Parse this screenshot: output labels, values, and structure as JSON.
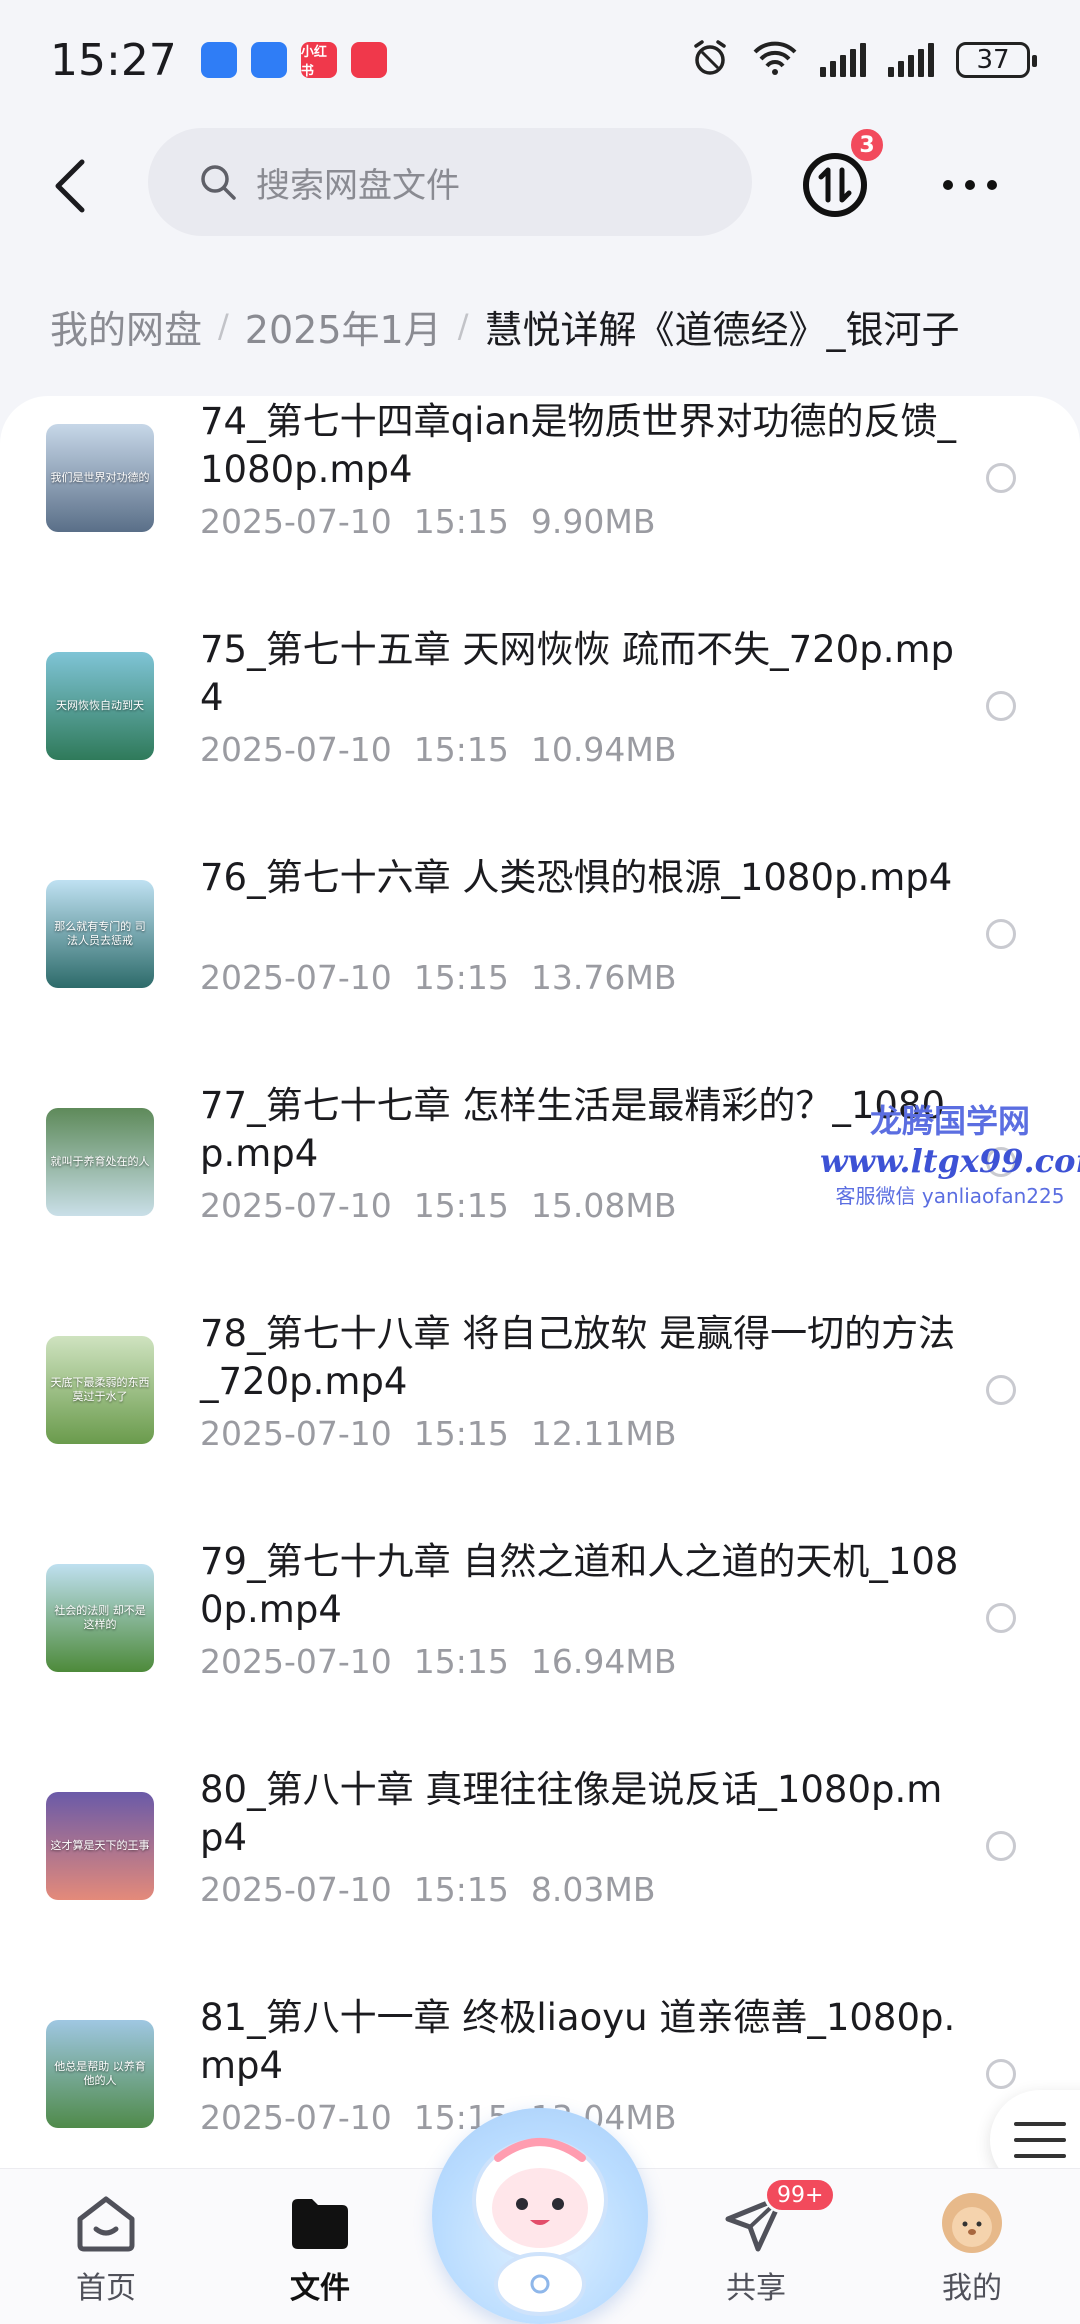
{
  "status_bar": {
    "time": "15:27",
    "notification_icons": [
      {
        "name": "app-notification-icon",
        "color": "#2f7df6",
        "text": ""
      },
      {
        "name": "app-notification-icon",
        "color": "#2f7df6",
        "text": ""
      },
      {
        "name": "xiaohongshu-icon",
        "color": "#f0384b",
        "text": "小红书"
      },
      {
        "name": "message-icon",
        "color": "#f0384b",
        "text": ""
      }
    ],
    "battery": "37"
  },
  "header": {
    "search_placeholder": "搜索网盘文件",
    "transfer_badge": "3"
  },
  "breadcrumb": {
    "items": [
      "我的网盘",
      "2025年1月"
    ],
    "current": "慧悦详解《道德经》_银河子"
  },
  "files": [
    {
      "name": "74_第七十四章qian是物质世界对功德的反馈_1080p.mp4",
      "date": "2025-07-10",
      "time": "15:15",
      "size": "9.90MB",
      "thumb_caption": "我们是世界对功德的",
      "thumb_colors": [
        "#c7d7e8",
        "#5a6f88"
      ]
    },
    {
      "name": "75_第七十五章  天网恢恢 疏而不失_720p.mp4",
      "date": "2025-07-10",
      "time": "15:15",
      "size": "10.94MB",
      "thumb_caption": "天网恢恢自动到天",
      "thumb_colors": [
        "#7fc4d6",
        "#2f7a5a"
      ]
    },
    {
      "name": "76_第七十六章 人类恐惧的根源_1080p.mp4",
      "date": "2025-07-10",
      "time": "15:15",
      "size": "13.76MB",
      "thumb_caption": "那么就有专门的 司法人员去惩戒",
      "thumb_colors": [
        "#bfe1f2",
        "#2d6b6a"
      ]
    },
    {
      "name": "77_第七十七章 怎样生活是最精彩的？_1080p.mp4",
      "date": "2025-07-10",
      "time": "15:15",
      "size": "15.08MB",
      "thumb_caption": "就叫于养育处在的人",
      "thumb_colors": [
        "#5e8a5a",
        "#c9dfe8"
      ]
    },
    {
      "name": "78_第七十八章 将自己放软 是赢得一切的方法_720p.mp4",
      "date": "2025-07-10",
      "time": "15:15",
      "size": "12.11MB",
      "thumb_caption": "天底下最柔弱的东西 莫过于水了",
      "thumb_colors": [
        "#cfe3c0",
        "#6a9b4c"
      ]
    },
    {
      "name": "79_第七十九章 自然之道和人之道的天机_1080p.mp4",
      "date": "2025-07-10",
      "time": "15:15",
      "size": "16.94MB",
      "thumb_caption": "社会的法则 却不是这样的",
      "thumb_colors": [
        "#bfe0f0",
        "#4d8a3a"
      ]
    },
    {
      "name": "80_第八十章 真理往往像是说反话_1080p.mp4",
      "date": "2025-07-10",
      "time": "15:15",
      "size": "8.03MB",
      "thumb_caption": "这才算是天下的王事",
      "thumb_colors": [
        "#6a5aa8",
        "#e48a7a"
      ]
    },
    {
      "name": "81_第八十一章 终极liaoyu 道亲德善_1080p.mp4",
      "date": "2025-07-10",
      "time": "15:15",
      "size": "13.04MB",
      "thumb_caption": "他总是帮助 以养育他的人",
      "thumb_colors": [
        "#9fc7e2",
        "#4f8a4a"
      ]
    }
  ],
  "watermark": {
    "title": "龙腾国学网",
    "url": "www.ltgx99.com",
    "contact": "客服微信 yanliaofan225"
  },
  "bottom_nav": {
    "items": [
      {
        "key": "home",
        "label": "首页",
        "active": false
      },
      {
        "key": "files",
        "label": "文件",
        "active": true
      },
      {
        "key": "share",
        "label": "共享",
        "active": false,
        "badge": "99+"
      },
      {
        "key": "mine",
        "label": "我的",
        "active": false
      }
    ]
  },
  "colors": {
    "accent": "#f24a5c",
    "background": "#f4f5f9",
    "card": "#ffffff"
  }
}
